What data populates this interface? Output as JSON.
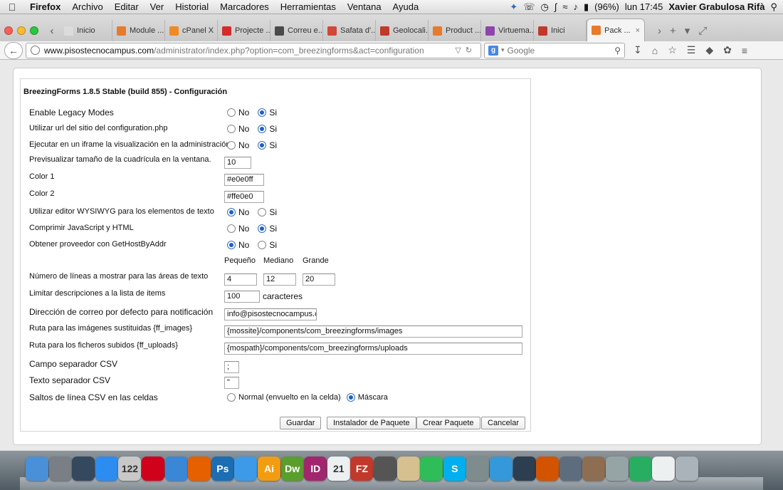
{
  "menubar": {
    "app": "Firefox",
    "items": [
      "Archivo",
      "Editar",
      "Ver",
      "Historial",
      "Marcadores",
      "Herramientas",
      "Ventana",
      "Ayuda"
    ],
    "battery": "(96%)",
    "clock": "lun 17:45",
    "user": "Xavier Grabulosa Rifà"
  },
  "tabs": [
    {
      "label": "Inicio",
      "icon": "page-icon",
      "color": "#dcdcdc"
    },
    {
      "label": "Module ...",
      "icon": "joomla-icon",
      "color": "#e87a2a"
    },
    {
      "label": "cPanel X",
      "icon": "cpanel-icon",
      "color": "#f08a24"
    },
    {
      "label": "Projecte ...",
      "icon": "gear-icon",
      "color": "#d42b2b"
    },
    {
      "label": "Correu e...",
      "icon": "mail-icon",
      "color": "#4a4a4a"
    },
    {
      "label": "Safata d'...",
      "icon": "gmail-icon",
      "color": "#d44638"
    },
    {
      "label": "Geolocali...",
      "icon": "w-icon",
      "color": "#c0392b"
    },
    {
      "label": "Product ...",
      "icon": "joomla-icon",
      "color": "#e87a2a"
    },
    {
      "label": "Virtuema...",
      "icon": "bars-icon",
      "color": "#8e44ad"
    },
    {
      "label": "Inici",
      "icon": "w-icon",
      "color": "#c0392b"
    },
    {
      "label": "Pack ...",
      "icon": "joomla-icon",
      "color": "#e87a2a",
      "active": true
    }
  ],
  "url": {
    "domain": "www.pisostecnocampus.com",
    "path": "/administrator/index.php?option=com_breezingforms&act=configuration",
    "search_placeholder": "Google"
  },
  "panel": {
    "title": "BreezingForms 1.8.5 Stable (build 855) - Configuración",
    "no_label": "No",
    "si_label": "Si",
    "enable_legacy": "Enable Legacy Modes",
    "use_config_url": "Utilizar url del sitio del configuration.php",
    "iframe": "Ejecutar en un iframe la visualización en la administración",
    "grid_preview": "Previsualizar tamaño de la cuadrícula en la ventana.",
    "grid_value": "10",
    "color1_label": "Color 1",
    "color1_value": "#e0e0ff",
    "color2_label": "Color 2",
    "color2_value": "#ffe0e0",
    "wysiwyg": "Utilizar editor WYSIWYG para los elementos de texto",
    "compress": "Comprimir JavaScript y HTML",
    "gethost": "Obtener proveedor con GetHostByAddr",
    "size_small": "Pequeño",
    "size_medium": "Mediano",
    "size_large": "Grande",
    "lines_label": "Número de líneas a mostrar para las áreas de texto",
    "lines_small": "4",
    "lines_medium": "12",
    "lines_large": "20",
    "limit_label": "Limitar descripciones a la lista de items",
    "limit_value": "100",
    "limit_suffix": "caracteres",
    "email_label": "Dirección de correo por defecto para notificación",
    "email_value": "info@pisostecnocampus.com",
    "images_label": "Ruta para las imágenes sustituidas {ff_images}",
    "images_value": "{mossite}/components/com_breezingforms/images",
    "uploads_label": "Ruta para los ficheros subidos {ff_uploads}",
    "uploads_value": "{mospath}/components/com_breezingforms/uploads",
    "csv_field_label": "Campo separador CSV",
    "csv_field_value": ";",
    "csv_text_label": "Texto separador CSV",
    "csv_text_value": "\"",
    "csv_newline_label": "Saltos de línea CSV en las celdas",
    "csv_newline_normal": "Normal (envuelto en la celda)",
    "csv_newline_mask": "Máscara",
    "save": "Guardar",
    "installer": "Instalador de Paquete",
    "create": "Crear Paquete",
    "cancel": "Cancelar"
  },
  "dock": [
    {
      "name": "finder-icon",
      "color": "#4a90d9",
      "text": ""
    },
    {
      "name": "launchpad-icon",
      "color": "#7a7f86",
      "text": ""
    },
    {
      "name": "mission-control-icon",
      "color": "#34495e",
      "text": ""
    },
    {
      "name": "app-store-icon",
      "color": "#2d8cf0",
      "text": ""
    },
    {
      "name": "calendar-notify-icon",
      "color": "#c8c8c8",
      "text": "122"
    },
    {
      "name": "opera-icon",
      "color": "#d0021b",
      "text": ""
    },
    {
      "name": "safari-icon",
      "color": "#3a87d6",
      "text": ""
    },
    {
      "name": "firefox-icon",
      "color": "#e66000",
      "text": ""
    },
    {
      "name": "photoshop-icon",
      "color": "#1c6db2",
      "text": "Ps"
    },
    {
      "name": "dropbox-icon",
      "color": "#3d9ae8",
      "text": ""
    },
    {
      "name": "illustrator-icon",
      "color": "#f39c12",
      "text": "Ai"
    },
    {
      "name": "dreamweaver-icon",
      "color": "#5a9e2e",
      "text": "Dw"
    },
    {
      "name": "indesign-icon",
      "color": "#a2266d",
      "text": "ID"
    },
    {
      "name": "calendar-icon",
      "color": "#ecf0f1",
      "text": "21"
    },
    {
      "name": "filezilla-icon",
      "color": "#c0392b",
      "text": "FZ"
    },
    {
      "name": "video-icon",
      "color": "#555",
      "text": ""
    },
    {
      "name": "contacts-icon",
      "color": "#d6c08f",
      "text": ""
    },
    {
      "name": "spotify-icon",
      "color": "#2ebd59",
      "text": ""
    },
    {
      "name": "skype-icon",
      "color": "#00aff0",
      "text": "S"
    },
    {
      "name": "system-prefs-icon",
      "color": "#7f8c8d",
      "text": ""
    },
    {
      "name": "itunes-icon",
      "color": "#3498db",
      "text": ""
    },
    {
      "name": "camera-icon",
      "color": "#2c3e50",
      "text": ""
    },
    {
      "name": "preview-icon",
      "color": "#d35400",
      "text": ""
    },
    {
      "name": "network-icon",
      "color": "#5d6d7e",
      "text": ""
    },
    {
      "name": "pages-icon",
      "color": "#8e6e53",
      "text": ""
    },
    {
      "name": "photo-icon",
      "color": "#95a5a6",
      "text": ""
    },
    {
      "name": "chrome-icon",
      "color": "#27ae60",
      "text": ""
    },
    {
      "name": "document-icon",
      "color": "#ecf0f1",
      "text": ""
    },
    {
      "name": "trash-icon",
      "color": "#aab3ba",
      "text": ""
    }
  ]
}
